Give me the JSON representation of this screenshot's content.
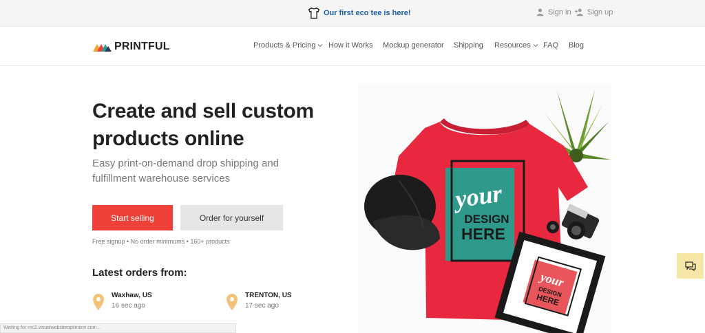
{
  "announcement": {
    "icon": "tshirt-icon",
    "text": "Our first eco tee is here!"
  },
  "auth": {
    "sign_in": "Sign in",
    "sign_up": "Sign up"
  },
  "brand": {
    "name": "PRINTFUL",
    "colors": {
      "red": "#ef4137",
      "orange": "#f2a33a",
      "teal": "#2a9d8f",
      "dark": "#273b5c"
    }
  },
  "nav": [
    {
      "label": "Products & Pricing",
      "dropdown": true
    },
    {
      "label": "How it Works",
      "dropdown": false
    },
    {
      "label": "Mockup generator",
      "dropdown": false
    },
    {
      "label": "Shipping",
      "dropdown": false
    },
    {
      "label": "Resources",
      "dropdown": true
    },
    {
      "label": "FAQ",
      "dropdown": false
    },
    {
      "label": "Blog",
      "dropdown": false
    }
  ],
  "hero": {
    "headline": "Create and sell custom products online",
    "subheading": "Easy print-on-demand drop shipping and fulfillment warehouse services",
    "primary_cta": "Start selling",
    "secondary_cta": "Order for yourself",
    "perks": "Free signup • No order minimums • 160+ products",
    "accent_color": "#ef4137"
  },
  "latest_orders": {
    "title": "Latest orders from:",
    "items": [
      {
        "city": "Waxhaw, US",
        "ago": "16 sec ago"
      },
      {
        "city": "TRENTON, US",
        "ago": "17 sec ago"
      }
    ]
  },
  "hero_image": {
    "shirt_text": {
      "line1": "your",
      "line2": "DESIGN",
      "line3": "HERE"
    },
    "frame_text": {
      "line1": "your",
      "line2": "DESIGN",
      "line3": "HERE"
    },
    "colors": {
      "shirt": "#e8283f",
      "print": "#2f9a8c"
    }
  },
  "status_bar": "Waiting for rec2.visualwebsiteoptimizer.com...",
  "chat_widget": {
    "icon": "chat-icon",
    "color": "#f6e7a6"
  }
}
